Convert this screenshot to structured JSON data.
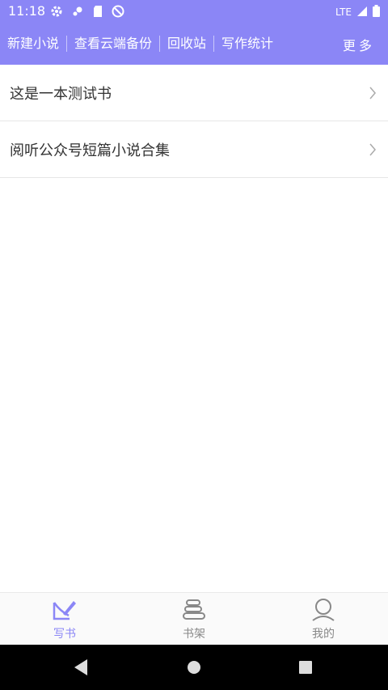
{
  "status_bar": {
    "time": "11:18",
    "network": "LTE",
    "left_icons": [
      "settings-icon",
      "gear-icon",
      "sd-card-icon",
      "do-not-disturb-icon"
    ],
    "right_icons": [
      "signal-icon",
      "battery-icon"
    ]
  },
  "toolbar": {
    "items": [
      "新建小说",
      "查看云端备份",
      "回收站",
      "写作统计"
    ],
    "more_label": "更多"
  },
  "books": [
    {
      "title": "这是一本测试书"
    },
    {
      "title": "阅听公众号短篇小说合集"
    }
  ],
  "tabs": [
    {
      "label": "写书",
      "icon": "write-book-icon",
      "active": true
    },
    {
      "label": "书架",
      "icon": "bookshelf-icon",
      "active": false
    },
    {
      "label": "我的",
      "icon": "profile-icon",
      "active": false
    }
  ],
  "colors": {
    "primary": "#8b86f6",
    "tab_inactive": "#888888",
    "text": "#333333"
  }
}
